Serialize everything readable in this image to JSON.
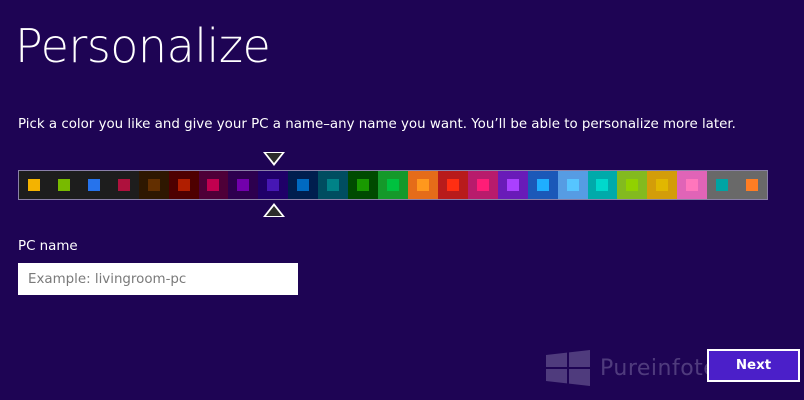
{
  "header": {
    "title": "Personalize"
  },
  "instructions": "Pick a color you like and give your PC a name–any name you want. You’ll be able to personalize more later.",
  "palette": {
    "selected_index": 8,
    "swatches": [
      {
        "background": "#1d1d1d",
        "accent": "#f4b300"
      },
      {
        "background": "#1d1d1d",
        "accent": "#78ba00"
      },
      {
        "background": "#1d1d1d",
        "accent": "#2673ec"
      },
      {
        "background": "#1d1d1d",
        "accent": "#ae113d"
      },
      {
        "background": "#2e1700",
        "accent": "#632f00"
      },
      {
        "background": "#4e0000",
        "accent": "#b01e00"
      },
      {
        "background": "#4e0038",
        "accent": "#c1004f"
      },
      {
        "background": "#2d004e",
        "accent": "#7200ac"
      },
      {
        "background": "#1f0068",
        "accent": "#4617b4"
      },
      {
        "background": "#001e4e",
        "accent": "#006ac1"
      },
      {
        "background": "#004d60",
        "accent": "#008287"
      },
      {
        "background": "#004a00",
        "accent": "#199900"
      },
      {
        "background": "#15992a",
        "accent": "#00c13f"
      },
      {
        "background": "#e56c19",
        "accent": "#ff981d"
      },
      {
        "background": "#b81b1b",
        "accent": "#ff2e12"
      },
      {
        "background": "#b81b6c",
        "accent": "#ff1d77"
      },
      {
        "background": "#691bb8",
        "accent": "#aa40ff"
      },
      {
        "background": "#1b58b8",
        "accent": "#1faeff"
      },
      {
        "background": "#569ce3",
        "accent": "#56c5ff"
      },
      {
        "background": "#00aaaa",
        "accent": "#00d8cc"
      },
      {
        "background": "#83ba1f",
        "accent": "#91d100"
      },
      {
        "background": "#d39d09",
        "accent": "#e1b700"
      },
      {
        "background": "#e064b7",
        "accent": "#ff76bc"
      },
      {
        "background": "#696969",
        "accent": "#00a4a4"
      },
      {
        "background": "#696969",
        "accent": "#ff7d23"
      }
    ]
  },
  "pc_name": {
    "label": "PC name",
    "placeholder": "Example: livingroom-pc",
    "value": ""
  },
  "watermark": {
    "text": "Pureinfotech",
    "icon": "windows-logo-icon"
  },
  "footer": {
    "next_label": "Next"
  }
}
